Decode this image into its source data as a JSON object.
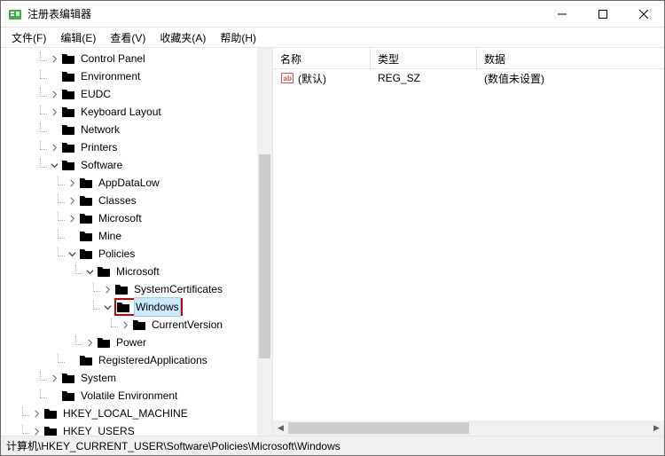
{
  "window": {
    "title": "注册表编辑器"
  },
  "menu": {
    "file": "文件(F)",
    "edit": "编辑(E)",
    "view": "查看(V)",
    "favorites": "收藏夹(A)",
    "help": "帮助(H)"
  },
  "columns": {
    "name": "名称",
    "type": "类型",
    "data": "数据"
  },
  "values": [
    {
      "name": "(默认)",
      "type": "REG_SZ",
      "data": "(数值未设置)"
    }
  ],
  "tree": {
    "items": [
      {
        "indent": 2,
        "expander": "closed",
        "label": "Control Panel"
      },
      {
        "indent": 2,
        "expander": "none",
        "label": "Environment"
      },
      {
        "indent": 2,
        "expander": "closed",
        "label": "EUDC"
      },
      {
        "indent": 2,
        "expander": "closed",
        "label": "Keyboard Layout"
      },
      {
        "indent": 2,
        "expander": "none",
        "label": "Network"
      },
      {
        "indent": 2,
        "expander": "closed",
        "label": "Printers"
      },
      {
        "indent": 2,
        "expander": "open",
        "label": "Software"
      },
      {
        "indent": 3,
        "expander": "closed",
        "label": "AppDataLow"
      },
      {
        "indent": 3,
        "expander": "closed",
        "label": "Classes"
      },
      {
        "indent": 3,
        "expander": "closed",
        "label": "Microsoft"
      },
      {
        "indent": 3,
        "expander": "none",
        "label": "Mine"
      },
      {
        "indent": 3,
        "expander": "open",
        "label": "Policies"
      },
      {
        "indent": 4,
        "expander": "open",
        "label": "Microsoft"
      },
      {
        "indent": 5,
        "expander": "closed",
        "label": "SystemCertificates"
      },
      {
        "indent": 5,
        "expander": "open",
        "label": "Windows",
        "selected": true,
        "boxed": true
      },
      {
        "indent": 6,
        "expander": "closed",
        "label": "CurrentVersion"
      },
      {
        "indent": 4,
        "expander": "closed",
        "label": "Power"
      },
      {
        "indent": 3,
        "expander": "none",
        "label": "RegisteredApplications"
      },
      {
        "indent": 2,
        "expander": "closed",
        "label": "System"
      },
      {
        "indent": 2,
        "expander": "none",
        "label": "Volatile Environment"
      },
      {
        "indent": 1,
        "expander": "closed",
        "label": "HKEY_LOCAL_MACHINE"
      },
      {
        "indent": 1,
        "expander": "closed",
        "label": "HKEY_USERS"
      }
    ]
  },
  "status": {
    "path": "计算机\\HKEY_CURRENT_USER\\Software\\Policies\\Microsoft\\Windows"
  }
}
